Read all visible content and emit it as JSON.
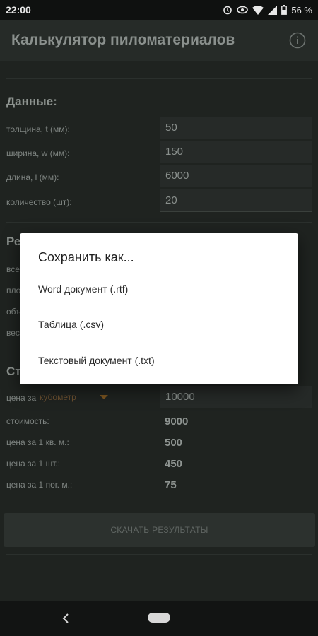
{
  "status_bar": {
    "time": "22:00",
    "battery_text": "56 %",
    "icons": [
      "alarm-icon",
      "eye-icon",
      "wifi-icon",
      "signal-icon",
      "battery-icon"
    ]
  },
  "app_bar": {
    "title": "Калькулятор пиломатериалов",
    "icon": "info-icon"
  },
  "data_section": {
    "title": "Данные:",
    "rows": [
      {
        "label": "толщина, t (мм):",
        "value": "50"
      },
      {
        "label": "ширина, w (мм):",
        "value": "150"
      },
      {
        "label": "длина, l (мм):",
        "value": "6000"
      },
      {
        "label": "количество (шт):",
        "value": "20"
      }
    ]
  },
  "results_section": {
    "title_fragment": "Ре",
    "row_fragments": [
      "все",
      "пло",
      "объ",
      "вес"
    ]
  },
  "cost_section": {
    "title_fragment": "Ст",
    "price_label": "цена за",
    "unit_selected": "кубометр",
    "price_value": "10000",
    "rows": [
      {
        "label": "стоимость:",
        "value": "9000"
      },
      {
        "label": "цена за 1 кв. м.:",
        "value": "500"
      },
      {
        "label": "цена за 1 шт.:",
        "value": "450"
      },
      {
        "label": "цена за 1 пог. м.:",
        "value": "75"
      }
    ]
  },
  "download_button": "СКАЧАТЬ РЕЗУЛЬТАТЫ",
  "dialog": {
    "title": "Сохранить как...",
    "options": [
      "Word документ (.rtf)",
      "Таблица (.csv)",
      "Текстовый документ (.txt)"
    ]
  },
  "colors": {
    "background": "#1f2320",
    "dialog": "#ffffff",
    "accent_orange": "#7a5420"
  }
}
